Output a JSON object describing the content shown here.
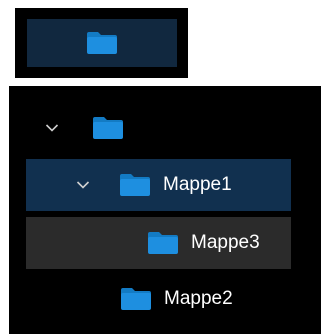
{
  "preview": {
    "icon": "folder-icon"
  },
  "tree": {
    "items": [
      {
        "label": "",
        "expanded": true,
        "icon": "folder-icon",
        "state": "normal"
      },
      {
        "label": "Mappe1",
        "expanded": true,
        "icon": "folder-icon",
        "state": "selected"
      },
      {
        "label": "Mappe3",
        "expanded": false,
        "icon": "folder-icon",
        "state": "hover"
      },
      {
        "label": "Mappe2",
        "expanded": false,
        "icon": "folder-icon",
        "state": "normal"
      }
    ]
  },
  "colors": {
    "panel_bg": "#000000",
    "selected_bg": "#11304f",
    "hover_bg": "#2b2b2b",
    "preview_bg": "#11283f",
    "folder_body": "#1e8fe0",
    "folder_tab": "#137bc4",
    "text": "#ffffff"
  }
}
